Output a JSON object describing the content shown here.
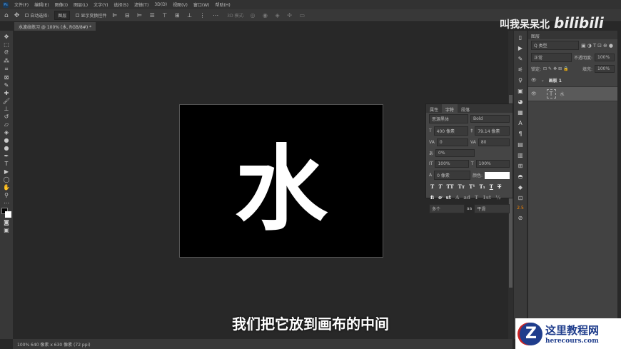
{
  "menu": [
    "文件(F)",
    "编辑(E)",
    "图像(I)",
    "图层(L)",
    "文字(Y)",
    "选择(S)",
    "滤镜(T)",
    "3D(D)",
    "视图(V)",
    "窗口(W)",
    "帮助(H)"
  ],
  "options": {
    "auto_select": "自动选择:",
    "layer_select": "图层",
    "show_transform": "显示变换控件",
    "mode_3d": "3D 模式:"
  },
  "doc_tab": "水波纹练习 @ 100% (水, RGB/8#) *",
  "canvas_text": "水",
  "status": "100%    640 像素 x 630 像素 (72 ppi)",
  "character": {
    "tabs": [
      "属性",
      "字符",
      "段落"
    ],
    "font": "思源黑体",
    "style": "Bold",
    "size": "400 像素",
    "leading": "79.14 像素",
    "kerning": "0",
    "tracking": "80",
    "scale_pct": "0%",
    "vscale": "100%",
    "hscale": "100%",
    "baseline": "0 像素",
    "color_label": "颜色:",
    "lang": "多个",
    "aa_label": "aa",
    "aa": "平滑",
    "icons": [
      "T",
      "T",
      "TT",
      "Tт",
      "T¹",
      "T₁",
      "T",
      "T"
    ],
    "icons2": [
      "fi",
      "ơ",
      "st",
      "A",
      "ad",
      "T",
      "1st",
      "½"
    ]
  },
  "layers": {
    "tab": "图层",
    "filter": "Q 类型",
    "blend": "正常",
    "opacity_label": "不透明度:",
    "opacity": "100%",
    "lock_label": "锁定:",
    "fill_label": "填充:",
    "fill": "100%",
    "group": "画板 1",
    "layer": "水"
  },
  "subtitle": "我们把它放到画布的中间",
  "watermark": {
    "name": "叫我呆呆北",
    "logo": "bilibili"
  },
  "brand": {
    "mark": "Z",
    "title": "这里教程网",
    "url": "herecours.com"
  }
}
